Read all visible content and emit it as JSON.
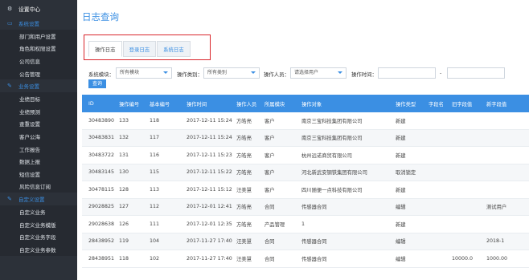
{
  "sidebar": {
    "header": "设置中心",
    "groups": [
      {
        "label": "系统设置",
        "items": [
          "部门和用户设置",
          "角色和权限设置",
          "公司信息",
          "公告管理"
        ]
      },
      {
        "label": "业务设置",
        "items": [
          "业绩目标",
          "业绩预测",
          "查重设置",
          "客户公海",
          "工作报告",
          "数据上报",
          "短信设置",
          "风险信息订阅"
        ]
      },
      {
        "label": "自定义设置",
        "items": [
          "自定义业务",
          "自定义业务模版",
          "自定义业务字段",
          "自定义业务参数"
        ]
      }
    ]
  },
  "page": {
    "title": "日志查询"
  },
  "tabs": [
    "操作日志",
    "登录日志",
    "系统日志"
  ],
  "filters": {
    "module_label": "系统模块：",
    "module_value": "所有模块",
    "type_label": "操作类别：",
    "type_value": "所有类别",
    "user_label": "操作人员：",
    "user_value": "请选择用户",
    "time_label": "操作时间：",
    "time_sep": "-",
    "query_button": "查询"
  },
  "table": {
    "columns": [
      "ID",
      "操作编号",
      "基本编号",
      "操作时间",
      "操作人员",
      "所属模块",
      "操作对象",
      "操作类型",
      "字段名",
      "旧字段值",
      "新字段值"
    ],
    "rows": [
      [
        "30483890",
        "133",
        "118",
        "2017-12-11 15:24",
        "方皓亮",
        "客户",
        "南京三宝科技集团有限公司",
        "新建",
        "",
        "",
        ""
      ],
      [
        "30483831",
        "132",
        "117",
        "2017-12-11 15:24",
        "方皓亮",
        "客户",
        "南京三宝科技集团有限公司",
        "新建",
        "",
        "",
        ""
      ],
      [
        "30483722",
        "131",
        "116",
        "2017-12-11 15:23",
        "方皓亮",
        "客户",
        "杭州远诺商贸有限公司",
        "新建",
        "",
        "",
        ""
      ],
      [
        "30483145",
        "130",
        "115",
        "2017-12-11 15:22",
        "方皓亮",
        "客户",
        "河北新武安钢铁集团有限公司",
        "取消锁定",
        "",
        "",
        ""
      ],
      [
        "30478115",
        "128",
        "113",
        "2017-12-11 15:12",
        "汪美慧",
        "客户",
        "四川随便一点科技有限公司",
        "新建",
        "",
        "",
        ""
      ],
      [
        "29028825",
        "127",
        "112",
        "2017-12-01 12:41",
        "方皓亮",
        "合同",
        "传感器合同",
        "编辑",
        "",
        "",
        "测试用户"
      ],
      [
        "29028638",
        "126",
        "111",
        "2017-12-01 12:35",
        "方皓亮",
        "产品管理",
        "1",
        "新建",
        "",
        "",
        ""
      ],
      [
        "28438952",
        "119",
        "104",
        "2017-11-27 17:40",
        "汪美慧",
        "合同",
        "传感器合同",
        "编辑",
        "",
        "",
        "2018-1"
      ],
      [
        "28438951",
        "118",
        "102",
        "2017-11-27 17:40",
        "汪美慧",
        "合同",
        "传感器合同",
        "编辑",
        "",
        "10000.0",
        "1000.00"
      ]
    ]
  }
}
